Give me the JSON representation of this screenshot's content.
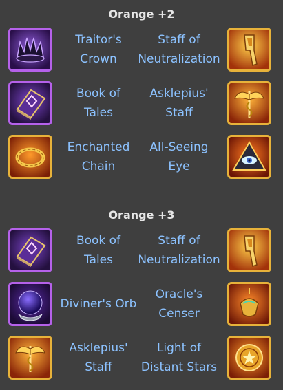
{
  "sections": [
    {
      "title": "Orange +2",
      "rows": [
        {
          "left_name": "Traitor's\nCrown",
          "left_icon": "crown-icon",
          "right_name": "Staff of\nNeutralization",
          "right_icon": "staff-icon"
        },
        {
          "left_name": "Book of\nTales",
          "left_icon": "book-icon",
          "right_name": "Asklepius'\nStaff",
          "right_icon": "winged-staff-icon"
        },
        {
          "left_name": "Enchanted\nChain",
          "left_icon": "chain-icon",
          "right_name": "All-Seeing\nEye",
          "right_icon": "eye-pyramid-icon"
        }
      ]
    },
    {
      "title": "Orange +3",
      "rows": [
        {
          "left_name": "Book of\nTales",
          "left_icon": "book-icon",
          "right_name": "Staff of\nNeutralization",
          "right_icon": "staff-icon"
        },
        {
          "left_name": "Diviner's Orb",
          "left_icon": "orb-icon",
          "right_name": "Oracle's\nCenser",
          "right_icon": "censer-icon"
        },
        {
          "left_name": "Asklepius'\nStaff",
          "left_icon": "winged-staff-icon",
          "right_name": "Light of\nDistant Stars",
          "right_icon": "star-coin-icon"
        }
      ]
    }
  ],
  "colors": {
    "background": "#3f3f3f",
    "heading": "#e6e6e6",
    "item_text": "#8cc2ff",
    "purple_frame": "#b561ea",
    "gold_frame": "#e7b23a"
  }
}
